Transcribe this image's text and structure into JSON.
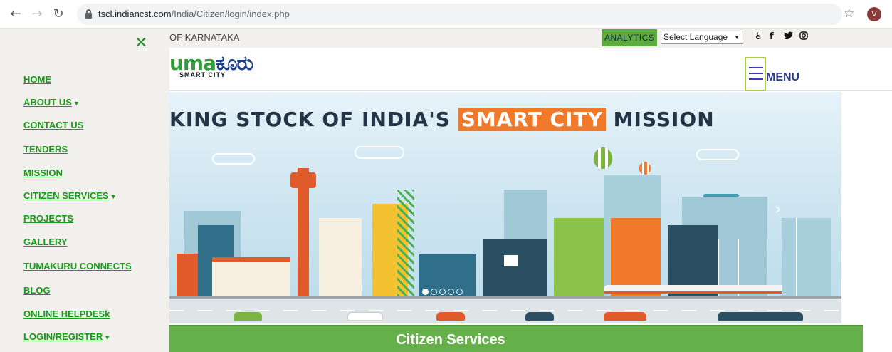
{
  "browser": {
    "url_host": "tscl.indiancst.com",
    "url_path": "/India/Citizen/login/index.php",
    "avatar_initial": "V"
  },
  "topbar": {
    "govt_text": "OF KARNATAKA",
    "analytics_label": "ANALYTICS",
    "language_select": "Select Language",
    "social_icons": [
      "accessibility-icon",
      "facebook-icon",
      "twitter-icon",
      "instagram-icon"
    ]
  },
  "header": {
    "logo_text": "uma",
    "logo_kannada": "ಕೂರು",
    "logo_sub": "SMART CITY",
    "menu_label": "MENU"
  },
  "banner": {
    "headline_pre": "KING STOCK OF INDIA'S ",
    "headline_highlight": "SMART CITY",
    "headline_post": " MISSION",
    "slide_count": 5,
    "active_slide": 1,
    "colors": {
      "highlight": "#f07a2a",
      "headline": "#263246"
    }
  },
  "citizen_services": {
    "title": "Citizen Services"
  },
  "sidemenu": {
    "items": [
      {
        "label": "HOME",
        "dropdown": false
      },
      {
        "label": "ABOUT US",
        "dropdown": true
      },
      {
        "label": "CONTACT US",
        "dropdown": false
      },
      {
        "label": "TENDERS",
        "dropdown": false
      },
      {
        "label": "MISSION",
        "dropdown": false
      },
      {
        "label": "CITIZEN SERVICES",
        "dropdown": true
      },
      {
        "label": "PROJECTS",
        "dropdown": false
      },
      {
        "label": "GALLERY",
        "dropdown": false
      },
      {
        "label": "TUMAKURU CONNECTS",
        "dropdown": false
      },
      {
        "label": "BLOG",
        "dropdown": false
      },
      {
        "label": "ONLINE HELPDESk",
        "dropdown": false
      },
      {
        "label": "LOGIN/REGISTER",
        "dropdown": true
      }
    ],
    "colors": {
      "link": "#1a9a1a"
    }
  }
}
